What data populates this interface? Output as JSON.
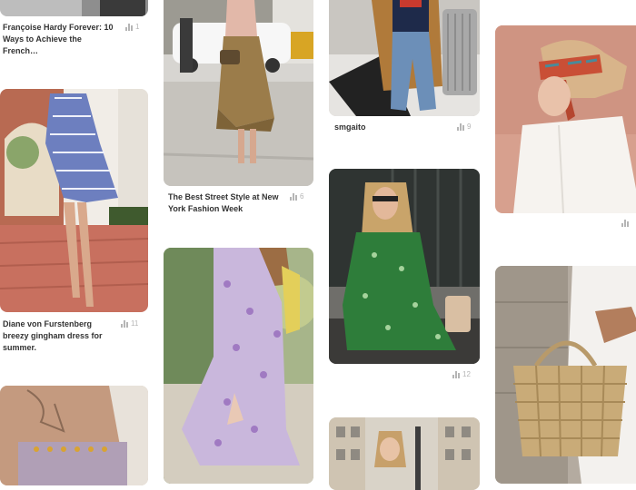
{
  "pins": [
    {
      "id": "francoise",
      "title": "Françoise Hardy Forever: 10 Ways to Achieve the French…",
      "count": "1"
    },
    {
      "id": "gingham",
      "title": "Diane von Furstenberg breezy gingham dress for summer.",
      "count": "11"
    },
    {
      "id": "crop-top",
      "title": "",
      "count": ""
    },
    {
      "id": "street-style",
      "title": "The Best Street Style at New York Fashion Week",
      "count": "6"
    },
    {
      "id": "floral-dress",
      "title": "",
      "count": ""
    },
    {
      "id": "smgaito",
      "title": "smgaito",
      "count": "9"
    },
    {
      "id": "green-dress",
      "title": "",
      "count": "12"
    },
    {
      "id": "city-street",
      "title": "",
      "count": ""
    },
    {
      "id": "headscarf",
      "title": "",
      "count": ""
    },
    {
      "id": "straw-bag",
      "title": "",
      "count": ""
    }
  ],
  "stats_icon": "bar-chart-icon"
}
